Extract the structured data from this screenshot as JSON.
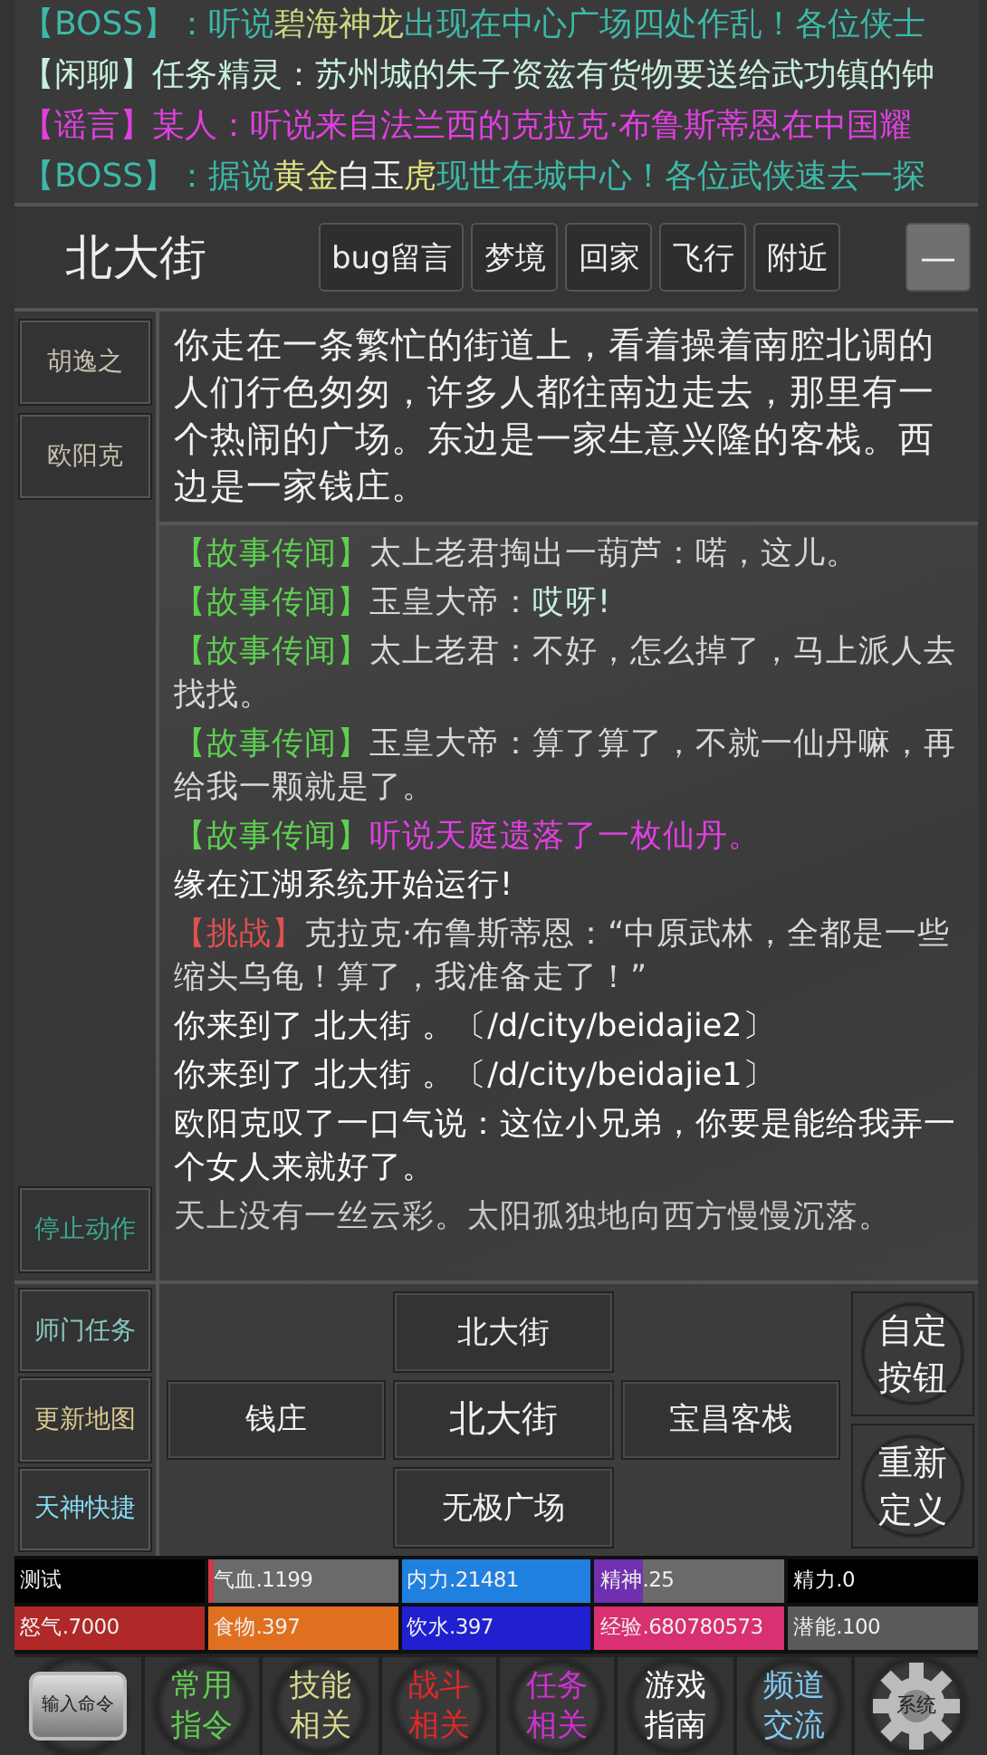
{
  "news": [
    [
      {
        "text": "【BOSS】：听说",
        "color": "#3db8a8"
      },
      {
        "text": "碧海神龙",
        "color": "#c8d880"
      },
      {
        "text": "出现在中心广场四处作乱！各位侠士",
        "color": "#3db8a8"
      }
    ],
    [
      {
        "text": "【闲聊】任务精灵：苏州城的朱子资兹有货物要送给武功镇的钟",
        "color": "#c8f0dc"
      }
    ],
    [
      {
        "text": "【谣言】某人：听说来自法兰西的克拉克·布鲁斯蒂恩在中国耀",
        "color": "#e040e0"
      }
    ],
    [
      {
        "text": "【BOSS】：据说",
        "color": "#3db8a8"
      },
      {
        "text": "黄金",
        "color": "#e0e080"
      },
      {
        "text": "白玉",
        "color": "#ffffff"
      },
      {
        "text": "虎",
        "color": "#e0e080"
      },
      {
        "text": "现世在城中心！各位武侠速去一探",
        "color": "#3db8a8"
      }
    ]
  ],
  "location": {
    "title": "北大街",
    "buttons": [
      "bug留言",
      "梦境",
      "回家",
      "飞行",
      "附近"
    ],
    "collapse": "—"
  },
  "npcs": [
    "胡逸之",
    "欧阳克"
  ],
  "description": "你走在一条繁忙的街道上，看着操着南腔北调的人们行色匆匆，许多人都往南边走去，那里有一个热闹的广场。东边是一家生意兴隆的客栈。西边是一家钱庄。",
  "log": [
    [
      {
        "text": "【故事传闻】",
        "color": "#5ed050"
      },
      {
        "text": "太上老君掏出一葫芦：喏，这儿。",
        "color": "#d8d8d8"
      }
    ],
    [
      {
        "text": "【故事传闻】",
        "color": "#5ed050"
      },
      {
        "text": "玉皇大帝：",
        "color": "#d8d8d8"
      },
      {
        "text": "哎呀!",
        "color": "#c8f0e0"
      }
    ],
    [
      {
        "text": "【故事传闻】",
        "color": "#5ed050"
      },
      {
        "text": "太上老君：不好，怎么掉了，马上派人去找找。",
        "color": "#d8d8d8"
      }
    ],
    [
      {
        "text": "【故事传闻】",
        "color": "#5ed050"
      },
      {
        "text": "玉皇大帝：算了算了，不就一仙丹嘛，再给我一颗就是了。",
        "color": "#d8d8d8"
      }
    ],
    [
      {
        "text": "【故事传闻】",
        "color": "#5ed050"
      },
      {
        "text": "听说天庭遗落了一枚仙丹。",
        "color": "#e040e0"
      }
    ],
    [
      {
        "text": "缘在江湖系统开始运行!",
        "color": "#ffffff"
      }
    ],
    [
      {
        "text": "【挑战】",
        "color": "#e05050"
      },
      {
        "text": "克拉克·布鲁斯蒂恩：“中原武林，全都是一些缩头乌龟！算了，我准备走了！”",
        "color": "#d8d8d8"
      }
    ],
    [
      {
        "text": "你来到了 北大街 。〔/d/city/beidajie2〕",
        "color": "#ffffff"
      }
    ],
    [
      {
        "text": "你来到了 北大街 。〔/d/city/beidajie1〕",
        "color": "#ffffff"
      }
    ],
    [
      {
        "text": "欧阳克叹了一口气说：这位小兄弟，你要是能给我弄一个女人来就好了。",
        "color": "#ffffff"
      }
    ],
    [
      {
        "text": "天上没有一丝云彩。太阳孤独地向西方慢慢沉落。",
        "color": "#c8c8c8"
      }
    ]
  ],
  "quick_actions": [
    {
      "label": "停止动作",
      "color": "#3aa890"
    },
    {
      "label": "师门任务",
      "color": "#88c8c0"
    },
    {
      "label": "更新地图",
      "color": "#d8c890"
    },
    {
      "label": "天神快捷",
      "color": "#88d8f0"
    }
  ],
  "exits": {
    "north": "北大街",
    "west": "钱庄",
    "center": "北大街",
    "east": "宝昌客栈",
    "south": "无极广场"
  },
  "custom_buttons": [
    "自定按钮",
    "重新定义"
  ],
  "stats": [
    {
      "label": "测试",
      "color": "#000000",
      "level": 1
    },
    {
      "label": "气血.1199",
      "color": "#d03848",
      "level": 0.03
    },
    {
      "label": "内力.21481",
      "color": "#2080e0",
      "level": 1
    },
    {
      "label": "精神.25",
      "color": "#7030b0",
      "level": 0.25
    },
    {
      "label": "精力.0",
      "color": "#000000",
      "level": 1
    },
    {
      "label": "怒气.7000",
      "color": "#b02828",
      "level": 1
    },
    {
      "label": "食物.397",
      "color": "#e07020",
      "level": 1
    },
    {
      "label": "饮水.397",
      "color": "#2020d0",
      "level": 1
    },
    {
      "label": "经验.680780573",
      "color": "#d83070",
      "level": 1
    },
    {
      "label": "潜能.100",
      "color": "#5a5a5a",
      "level": 1
    }
  ],
  "toolbar": [
    {
      "kind": "input",
      "label": "输入命令"
    },
    {
      "kind": "text",
      "label": "常用指令",
      "color": "#60d050"
    },
    {
      "kind": "text",
      "label": "技能相关",
      "color": "#d8d890"
    },
    {
      "kind": "text",
      "label": "战斗相关",
      "color": "#e02828"
    },
    {
      "kind": "text",
      "label": "任务相关",
      "color": "#d030d0"
    },
    {
      "kind": "text",
      "label": "游戏指南",
      "color": "#ffffff"
    },
    {
      "kind": "text",
      "label": "频道交流",
      "color": "#80c8f0"
    },
    {
      "kind": "gear",
      "label": "系统"
    }
  ]
}
